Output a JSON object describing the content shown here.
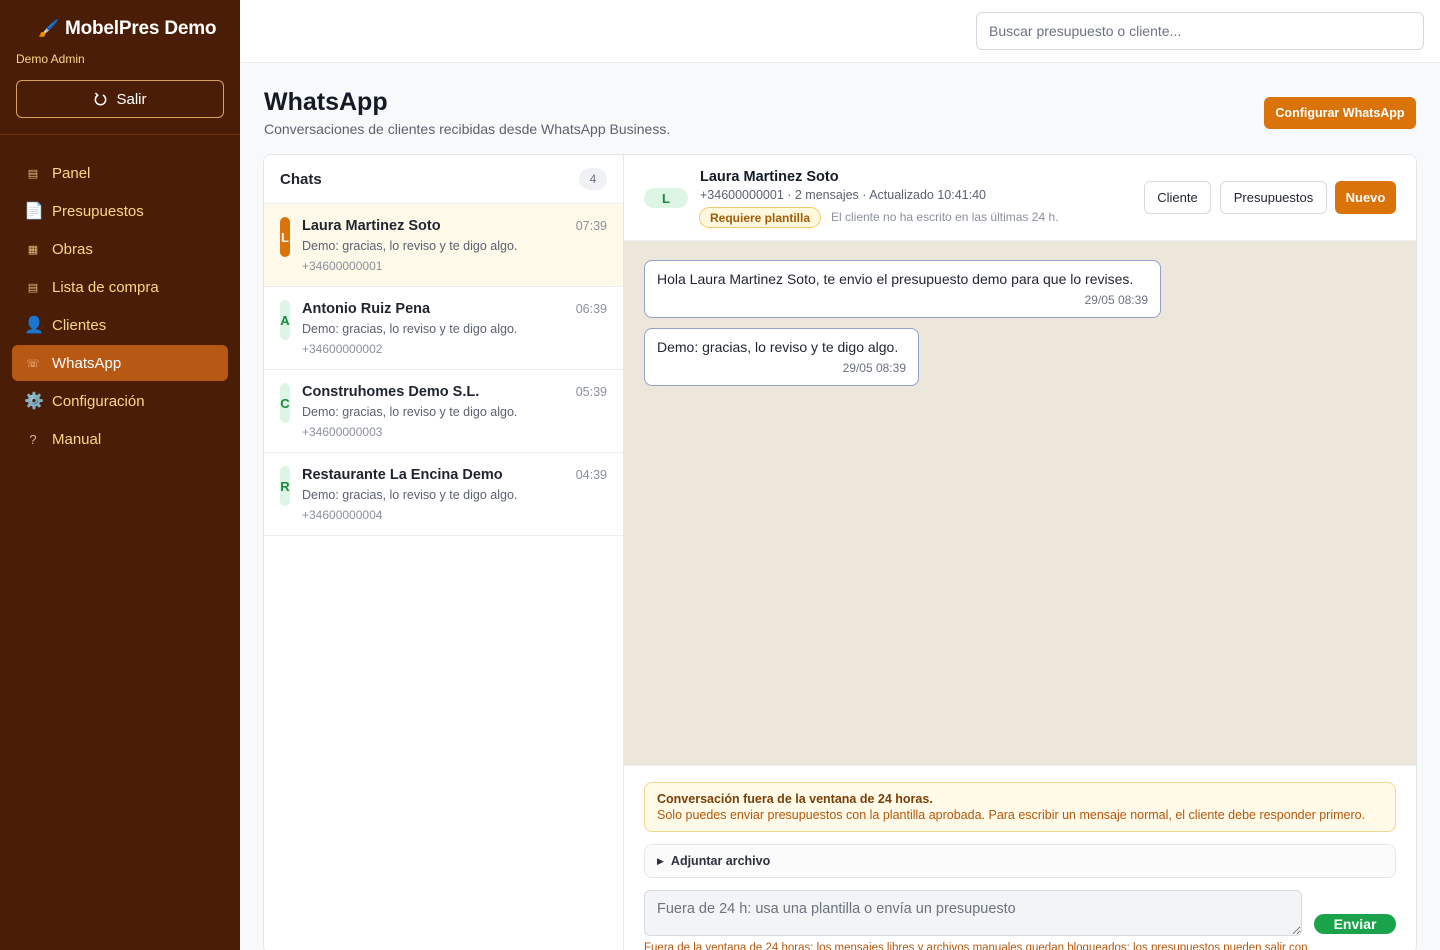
{
  "sidebar": {
    "brand": "MobelPres Demo",
    "brand_icon": "paintbrush-icon",
    "user": "Demo Admin",
    "logout_label": "Salir",
    "items": [
      {
        "label": "Panel",
        "icon": "grid-icon"
      },
      {
        "label": "Presupuestos",
        "icon": "document-icon"
      },
      {
        "label": "Obras",
        "icon": "grid-icon"
      },
      {
        "label": "Lista de compra",
        "icon": "list-icon"
      },
      {
        "label": "Clientes",
        "icon": "user-icon"
      },
      {
        "label": "WhatsApp",
        "icon": "phone-icon"
      },
      {
        "label": "Configuración",
        "icon": "gear-icon"
      },
      {
        "label": "Manual",
        "icon": "question-icon"
      }
    ]
  },
  "topbar": {
    "search_placeholder": "Buscar presupuesto o cliente..."
  },
  "page": {
    "title": "WhatsApp",
    "subtitle": "Conversaciones de clientes recibidas desde WhatsApp Business.",
    "config_button": "Configurar WhatsApp"
  },
  "chats": {
    "title": "Chats",
    "count": "4",
    "items": [
      {
        "initial": "L",
        "name": "Laura Martinez Soto",
        "time": "07:39",
        "preview": "Demo: gracias, lo reviso y te digo algo.",
        "phone": "+34600000001"
      },
      {
        "initial": "A",
        "name": "Antonio Ruiz Pena",
        "time": "06:39",
        "preview": "Demo: gracias, lo reviso y te digo algo.",
        "phone": "+34600000002"
      },
      {
        "initial": "C",
        "name": "Construhomes Demo S.L.",
        "time": "05:39",
        "preview": "Demo: gracias, lo reviso y te digo algo.",
        "phone": "+34600000003"
      },
      {
        "initial": "R",
        "name": "Restaurante La Encina Demo",
        "time": "04:39",
        "preview": "Demo: gracias, lo reviso y te digo algo.",
        "phone": "+34600000004"
      }
    ]
  },
  "conversation": {
    "initial": "L",
    "name": "Laura Martinez Soto",
    "meta": "+34600000001 · 2 mensajes · Actualizado 10:41:40",
    "badge": "Requiere plantilla",
    "note": "El cliente no ha escrito en las últimas 24 h.",
    "buttons": {
      "cliente": "Cliente",
      "presupuestos": "Presupuestos",
      "nuevo": "Nuevo"
    },
    "messages": [
      {
        "text": "Hola Laura Martinez Soto, te envio el presupuesto demo para que lo revises.",
        "time": "29/05 08:39"
      },
      {
        "text": "Demo: gracias, lo reviso y te digo algo.",
        "time": "29/05 08:39"
      }
    ]
  },
  "composer": {
    "warning_title": "Conversación fuera de la ventana de 24 horas.",
    "warning_text": "Solo puedes enviar presupuestos con la plantilla aprobada. Para escribir un mensaje normal, el cliente debe responder primero.",
    "attach_label": "Adjuntar archivo",
    "input_placeholder": "Fuera de 24 h: usa una plantilla o envía un presupuesto",
    "send_label": "Enviar",
    "footnote": "Fuera de la ventana de 24 horas: los mensajes libres y archivos manuales quedan bloqueados; los presupuestos pueden salir con"
  },
  "colors": {
    "sidebar_bg": "#4a1d06",
    "accent": "#d9730a",
    "active_nav": "#b85815",
    "send_green": "#1aa34a",
    "chat_bg": "#ede6db"
  }
}
